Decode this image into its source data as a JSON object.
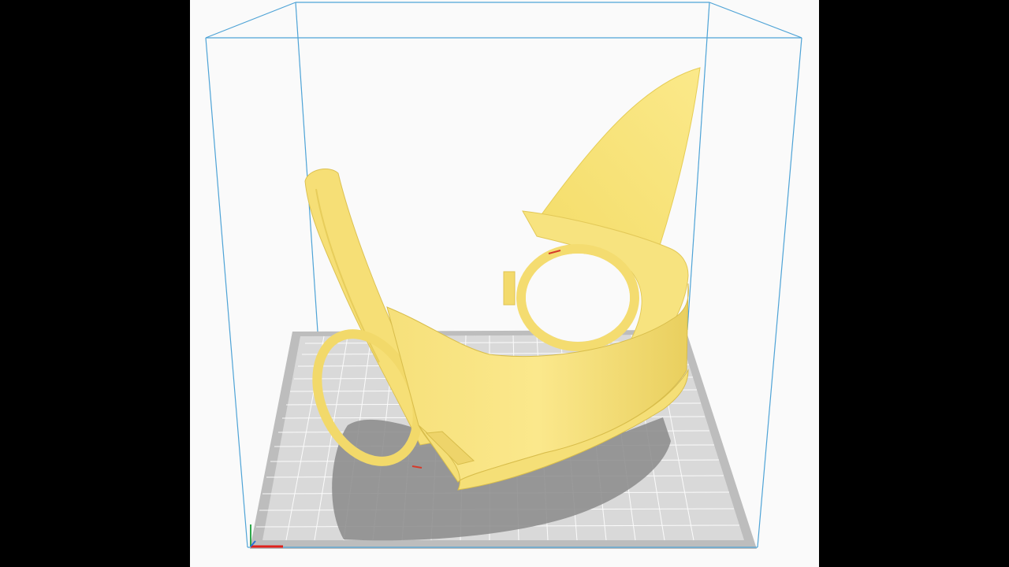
{
  "viewport": {
    "background": "#fafafa",
    "accent_model": "#f9e27a",
    "build_volume_color": "#4ea3d6",
    "plate_color": "#c8c8c8",
    "grid_color": "#ffffff",
    "shadow_color": "#8a8a8a",
    "axis_x_color": "#e0201a",
    "axis_y_color": "#2ea84a",
    "axis_z_color": "#2a6fd6"
  },
  "model": {
    "icon": "3d-model-icon"
  }
}
